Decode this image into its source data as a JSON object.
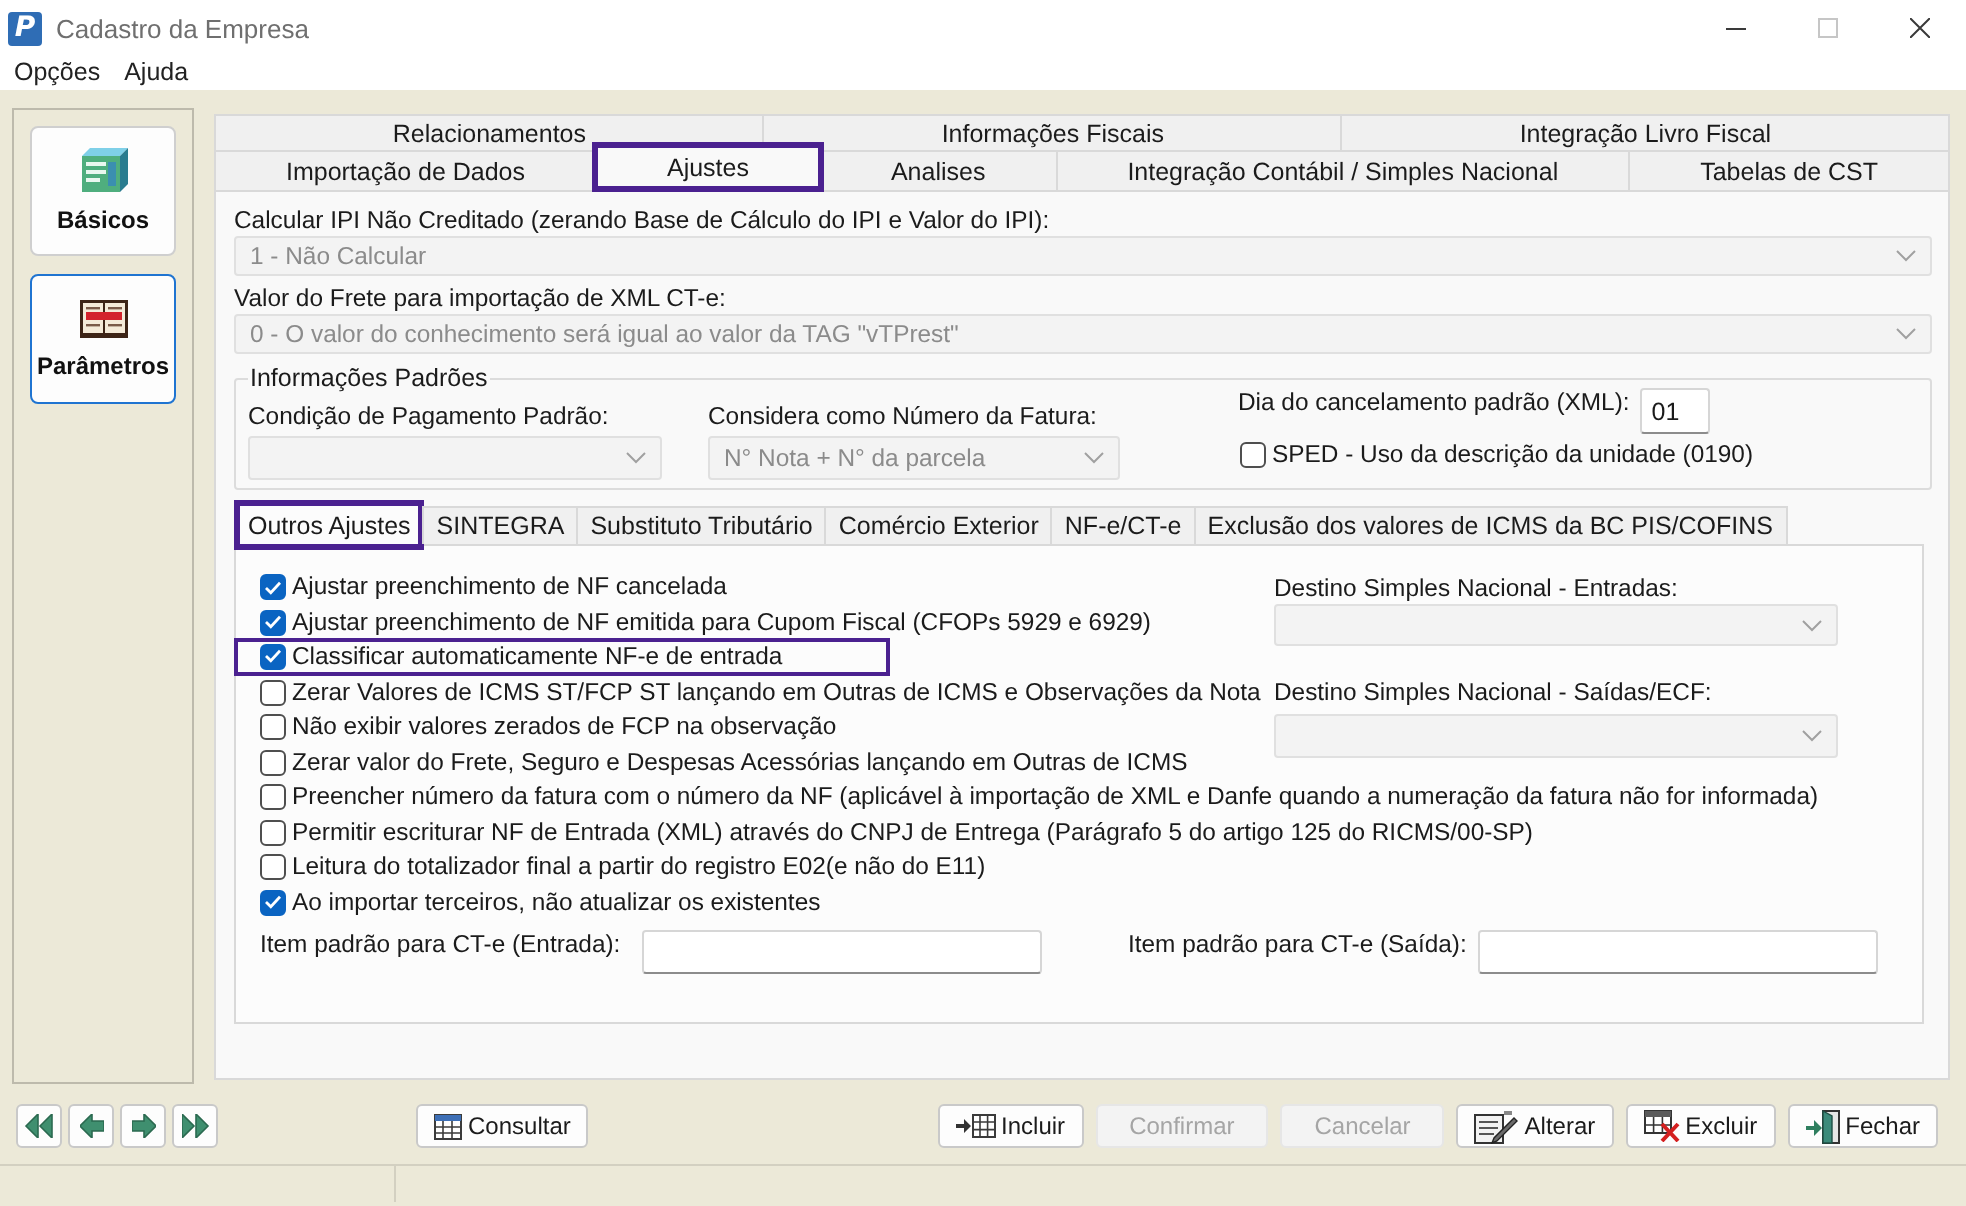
{
  "window": {
    "logo": "P",
    "title": "Cadastro da Empresa",
    "maximize_disabled": true
  },
  "menu": [
    {
      "label": "Opções"
    },
    {
      "label": "Ajuda"
    }
  ],
  "sidebar": {
    "items": [
      {
        "label": "Básicos",
        "kind": "box",
        "selected": false
      },
      {
        "label": "Parâmetros",
        "kind": "book",
        "selected": true
      }
    ]
  },
  "tab_rows": [
    {
      "tabs": [
        {
          "label": "Relacionamentos",
          "selected": false,
          "highlighted": false
        },
        {
          "label": "Informações Fiscais",
          "selected": false,
          "highlighted": false
        },
        {
          "label": "Integração Livro Fiscal",
          "selected": false,
          "highlighted": false
        }
      ]
    },
    {
      "tabs": [
        {
          "label": "Importação de Dados",
          "selected": false,
          "highlighted": false
        },
        {
          "label": "Ajustes",
          "selected": true,
          "highlighted": true
        },
        {
          "label": "Analises",
          "selected": false,
          "highlighted": false
        },
        {
          "label": "Integração Contábil / Simples Nacional",
          "selected": false,
          "highlighted": false
        },
        {
          "label": "Tabelas de CST",
          "selected": false,
          "highlighted": false
        }
      ]
    }
  ],
  "ajustes": {
    "calcular_ipi": {
      "label": "Calcular IPI Não Creditado (zerando Base de Cálculo do IPI e Valor do IPI):",
      "value": "1 - Não Calcular",
      "disabled": true
    },
    "valor_frete": {
      "label": "Valor do Frete para importação de XML CT-e:",
      "value": "0 - O valor do conhecimento será igual ao valor da TAG \"vTPrest\"",
      "disabled": true
    },
    "informacoes_padroes": {
      "legend": "Informações Padrões",
      "condicao_pagamento": {
        "label": "Condição de Pagamento Padrão:",
        "disabled": true
      },
      "numero_fatura": {
        "label": "Considera como Número da Fatura:",
        "value": "N° Nota + N° da parcela",
        "disabled": true
      },
      "dia_cancelamento": {
        "label": "Dia do cancelamento padrão (XML):",
        "value": "01"
      },
      "sped": {
        "label": "SPED - Uso da descrição da unidade (0190)",
        "checked": false
      }
    },
    "sub_tabs": [
      {
        "label": "Outros Ajustes",
        "selected": true,
        "highlighted": true
      },
      {
        "label": "SINTEGRA",
        "selected": false,
        "highlighted": false
      },
      {
        "label": "Substituto Tributário",
        "selected": false,
        "highlighted": false
      },
      {
        "label": "Comércio Exterior",
        "selected": false,
        "highlighted": false
      },
      {
        "label": "NF-e/CT-e",
        "selected": false,
        "highlighted": false
      },
      {
        "label": "Exclusão dos valores de ICMS da BC PIS/COFINS",
        "selected": false,
        "highlighted": false
      }
    ],
    "outros_ajustes": {
      "options": [
        {
          "label": "Ajustar preenchimento de NF cancelada",
          "checked": true,
          "highlighted": false
        },
        {
          "label": "Ajustar preenchimento de NF emitida para Cupom Fiscal (CFOPs 5929 e 6929)",
          "checked": true,
          "highlighted": false
        },
        {
          "label": "Classificar automaticamente NF-e de entrada",
          "checked": true,
          "highlighted": true
        },
        {
          "label": "Zerar Valores de ICMS ST/FCP ST lançando em Outras de ICMS e Observações da Nota",
          "checked": false,
          "highlighted": false
        },
        {
          "label": "Não exibir valores zerados de FCP na observação",
          "checked": false,
          "highlighted": false
        },
        {
          "label": "Zerar valor do Frete, Seguro e Despesas Acessórias lançando em Outras de ICMS",
          "checked": false,
          "highlighted": false
        },
        {
          "label": "Preencher número da fatura com o número da NF (aplicável à importação de XML e Danfe quando a numeração da fatura não for informada)",
          "checked": false,
          "highlighted": false
        },
        {
          "label": "Permitir escriturar NF de Entrada (XML) através do CNPJ de Entrega (Parágrafo 5 do artigo 125 do RICMS/00-SP)",
          "checked": false,
          "highlighted": false
        },
        {
          "label": "Leitura do totalizador final a partir do registro E02(e não do E11)",
          "checked": false,
          "highlighted": false
        },
        {
          "label": "Ao importar terceiros, não atualizar os existentes",
          "checked": true,
          "highlighted": false
        }
      ],
      "destino_entradas": {
        "label": "Destino Simples Nacional - Entradas:",
        "disabled": true
      },
      "destino_saidas": {
        "label": "Destino Simples Nacional - Saídas/ECF:",
        "disabled": true
      },
      "item_cte_entrada": {
        "label": "Item padrão para CT-e (Entrada):"
      },
      "item_cte_saida": {
        "label": "Item padrão para CT-e (Saída):"
      }
    }
  },
  "toolbar": {
    "nav": [
      {
        "kind": "first"
      },
      {
        "kind": "previous"
      },
      {
        "kind": "next"
      },
      {
        "kind": "last"
      }
    ],
    "left": [
      {
        "label": "Consultar",
        "kind": "query",
        "disabled": false
      }
    ],
    "right": [
      {
        "label": "Incluir",
        "kind": "insert",
        "disabled": false
      },
      {
        "label": "Confirmar",
        "kind": "confirm",
        "disabled": true
      },
      {
        "label": "Cancelar",
        "kind": "cancel",
        "disabled": true
      },
      {
        "label": "Alterar",
        "kind": "edit",
        "disabled": false
      },
      {
        "label": "Excluir",
        "kind": "delete",
        "disabled": false
      },
      {
        "label": "Fechar",
        "kind": "close",
        "disabled": false
      }
    ]
  }
}
